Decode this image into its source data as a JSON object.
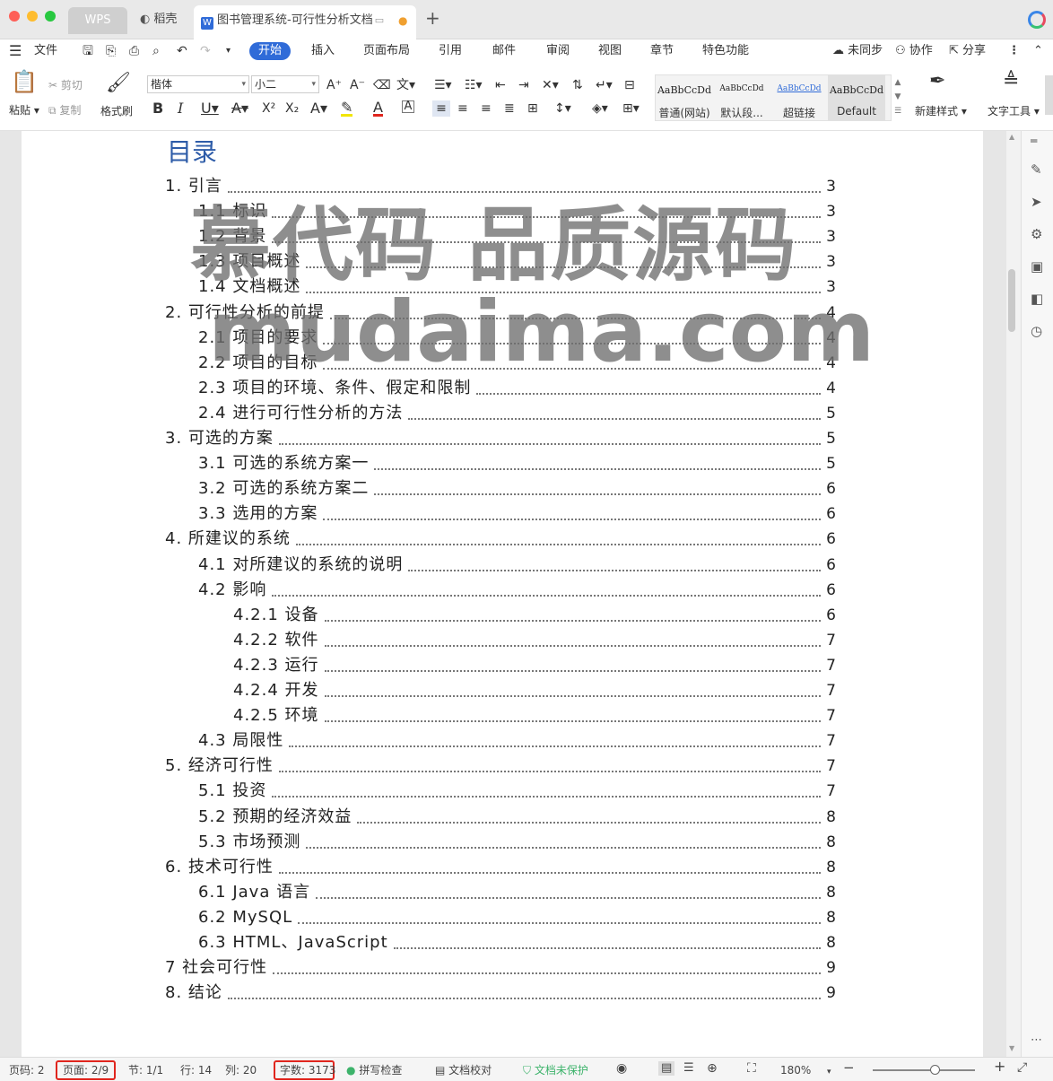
{
  "titlebar": {
    "tabs": [
      {
        "label": "WPS"
      },
      {
        "label": "稻壳"
      },
      {
        "label": "图书管理系统-可行性分析文档"
      }
    ],
    "add_tab": "+"
  },
  "menubar": {
    "file": "文件",
    "tabs": [
      "开始",
      "插入",
      "页面布局",
      "引用",
      "邮件",
      "审阅",
      "视图",
      "章节",
      "特色功能"
    ],
    "active_tab": "开始",
    "sync": "未同步",
    "collab": "协作",
    "share": "分享"
  },
  "ribbon": {
    "paste": "粘贴",
    "cut": "剪切",
    "copy": "复制",
    "format_painter": "格式刷",
    "font_name": "楷体",
    "font_size": "小二",
    "styles": [
      {
        "preview": "AaBbCcDd",
        "name": "普通(网站)"
      },
      {
        "preview": "AaBbCcDd",
        "name": "默认段..."
      },
      {
        "preview": "AaBbCcDd",
        "name": "超链接"
      },
      {
        "preview": "AaBbCcDd",
        "name": "Default"
      }
    ],
    "new_style": "新建样式",
    "text_tools": "文字工具"
  },
  "document": {
    "toc_title": "目录",
    "toc": [
      {
        "label": "1. 引言",
        "page": "3"
      },
      {
        "label": "1.1 标识",
        "page": "3"
      },
      {
        "label": "1.2 背景",
        "page": "3"
      },
      {
        "label": "1.3 项目概述",
        "page": "3"
      },
      {
        "label": "1.4 文档概述",
        "page": "3"
      },
      {
        "label": "2. 可行性分析的前提",
        "page": "4"
      },
      {
        "label": "2.1 项目的要求",
        "page": "4"
      },
      {
        "label": "2.2 项目的目标",
        "page": "4"
      },
      {
        "label": "2.3 项目的环境、条件、假定和限制",
        "page": "4"
      },
      {
        "label": "2.4 进行可行性分析的方法",
        "page": "5"
      },
      {
        "label": "3. 可选的方案",
        "page": "5"
      },
      {
        "label": "3.1 可选的系统方案一",
        "page": "5"
      },
      {
        "label": "3.2 可选的系统方案二",
        "page": "6"
      },
      {
        "label": "3.3 选用的方案",
        "page": "6"
      },
      {
        "label": "4. 所建议的系统",
        "page": "6"
      },
      {
        "label": "4.1 对所建议的系统的说明",
        "page": "6"
      },
      {
        "label": "4.2 影响",
        "page": "6"
      },
      {
        "label": "4.2.1 设备",
        "page": "6"
      },
      {
        "label": "4.2.2 软件",
        "page": "7"
      },
      {
        "label": "4.2.3 运行",
        "page": "7"
      },
      {
        "label": "4.2.4 开发",
        "page": "7"
      },
      {
        "label": "4.2.5 环境",
        "page": "7"
      },
      {
        "label": "4.3 局限性",
        "page": "7"
      },
      {
        "label": "5. 经济可行性",
        "page": "7"
      },
      {
        "label": "5.1 投资",
        "page": "7"
      },
      {
        "label": "5.2 预期的经济效益",
        "page": "8"
      },
      {
        "label": "5.3 市场预测",
        "page": "8"
      },
      {
        "label": "6. 技术可行性",
        "page": "8"
      },
      {
        "label": "6.1 Java 语言",
        "page": "8"
      },
      {
        "label": "6.2 MySQL",
        "page": "8"
      },
      {
        "label": "6.3 HTML、JavaScript",
        "page": "8"
      },
      {
        "label": "7 社会可行性",
        "page": "9"
      },
      {
        "label": "8. 结论",
        "page": "9"
      }
    ],
    "watermark_line1": "慕代码 品质源码",
    "watermark_line2": "mudaima.com"
  },
  "statusbar": {
    "page_num": "页码: 2",
    "page": "页面: 2/9",
    "section": "节: 1/1",
    "row": "行: 14",
    "col": "列: 20",
    "word_count": "字数: 3173",
    "spell_check": "拼写检查",
    "doc_proof": "文档校对",
    "doc_protect": "文档未保护",
    "zoom": "180%"
  }
}
